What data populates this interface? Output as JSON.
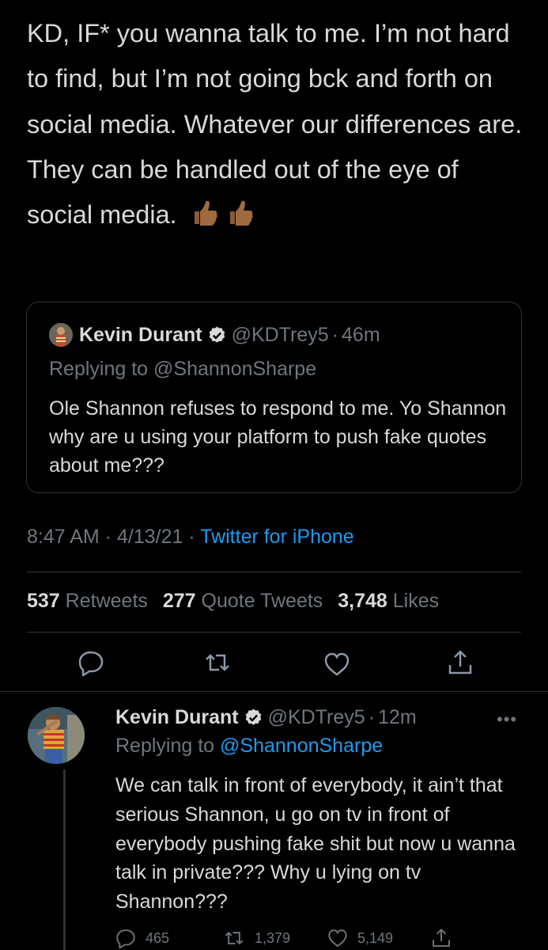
{
  "main_tweet": {
    "text": "KD, IF* you wanna talk to me. I’m not hard to find, but I’m not going bck and forth on social media. Whatever our differences are. They can be handled out of the eye of social media.",
    "emoji": [
      "thumbs-up-medium-dark-skin-tone",
      "thumbs-up-medium-dark-skin-tone"
    ]
  },
  "quoted_tweet": {
    "name": "Kevin Durant",
    "handle": "@KDTrey5",
    "time": "46m",
    "separator": "·",
    "replying_to": "Replying to @ShannonSharpe",
    "text": "Ole Shannon refuses to respond to me. Yo Shannon why are u using your platform to push fake quotes about me???"
  },
  "meta": {
    "time": "8:47 AM",
    "date": "4/13/21",
    "separator": "·",
    "source": "Twitter for iPhone"
  },
  "stats": {
    "retweets": "537",
    "retweets_label": "Retweets",
    "quote_tweets": "277",
    "quote_tweets_label": "Quote Tweets",
    "likes": "3,748",
    "likes_label": "Likes"
  },
  "actions": [
    "reply-icon",
    "retweet-icon",
    "like-icon",
    "share-icon"
  ],
  "reply_tweet": {
    "name": "Kevin Durant",
    "handle": "@KDTrey5",
    "time": "12m",
    "separator": "·",
    "more": "•••",
    "replying_prefix": "Replying to",
    "replying_mention": "@ShannonSharpe",
    "text": "We can talk in front of everybody, it ain’t that serious Shannon, u go on tv in front of everybody pushing fake shit but now u wanna talk in private??? Why u lying on tv Shannon???",
    "reply_count": "465",
    "retweet_count": "1,379",
    "like_count": "5,149"
  },
  "colors": {
    "background": "#000000",
    "text": "#d9d9d9",
    "secondary": "#6e767d",
    "link": "#1d9bf0",
    "divider": "#2f3336"
  }
}
